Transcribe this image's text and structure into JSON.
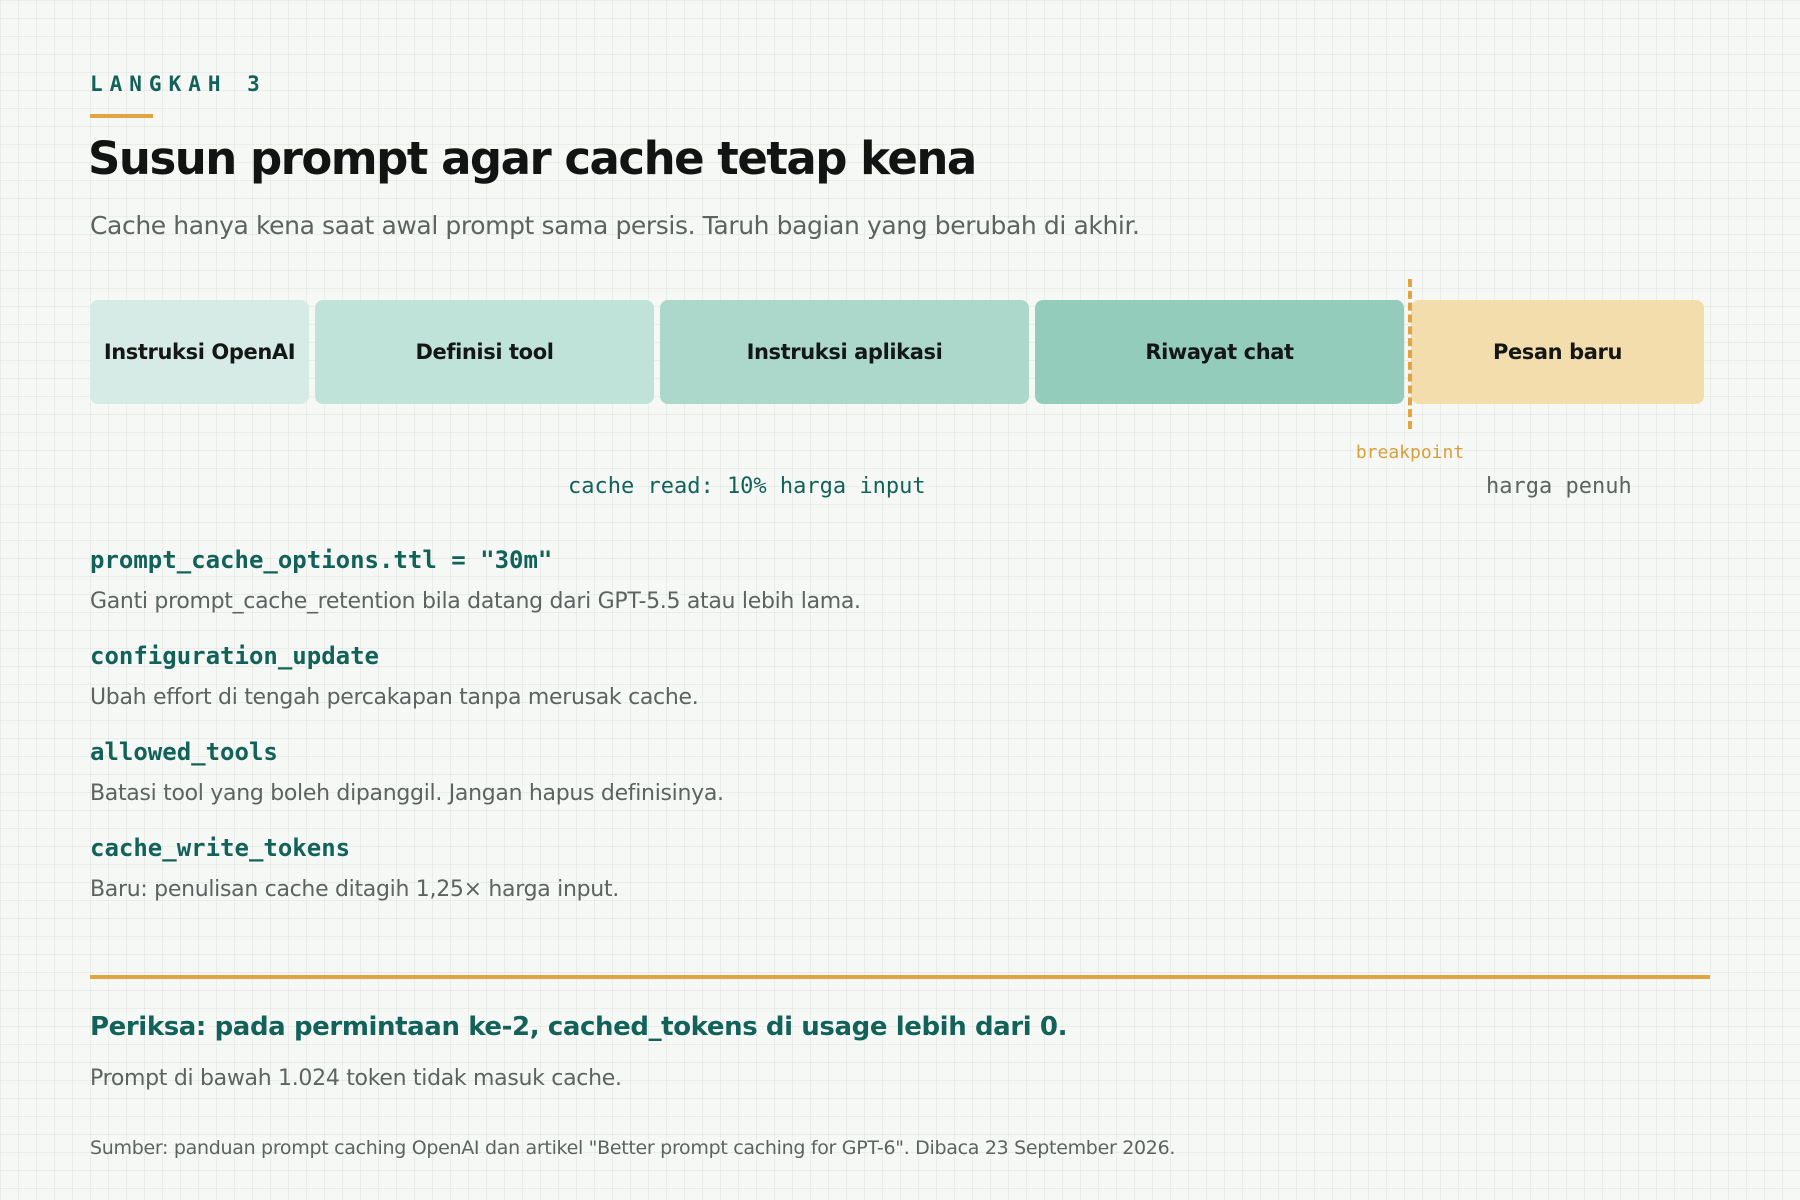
{
  "header": {
    "eyebrow": "LANGKAH 3",
    "title": "Susun prompt agar cache tetap kena",
    "subtitle": "Cache hanya kena saat awal prompt sama persis. Taruh bagian yang berubah di akhir."
  },
  "prompt_bar": {
    "segments": [
      {
        "label": "Instruksi OpenAI",
        "color": "#d6ebe5"
      },
      {
        "label": "Definisi tool",
        "color": "#c0e3d9"
      },
      {
        "label": "Instruksi aplikasi",
        "color": "#acd8cb"
      },
      {
        "label": "Riwayat chat",
        "color": "#94ccbc"
      },
      {
        "label": "Pesan baru",
        "color": "#f3ddad"
      }
    ],
    "breakpoint_label": "breakpoint",
    "breakpoint_color": "#e1a43f",
    "cache_read_label": "cache read: 10% harga input",
    "full_price_label": "harga penuh"
  },
  "options": [
    {
      "code": "prompt_cache_options.ttl = \"30m\"",
      "desc": "Ganti prompt_cache_retention bila datang dari GPT-5.5 atau lebih lama."
    },
    {
      "code": "configuration_update",
      "desc": "Ubah effort di tengah percakapan tanpa merusak cache."
    },
    {
      "code": "allowed_tools",
      "desc": "Batasi tool yang boleh dipanggil. Jangan hapus definisinya."
    },
    {
      "code": "cache_write_tokens",
      "desc": "Baru: penulisan cache ditagih 1,25× harga input."
    }
  ],
  "footer": {
    "check": "Periksa: pada permintaan ke-2, cached_tokens di usage lebih dari 0.",
    "note": "Prompt di bawah 1.024 token tidak masuk cache.",
    "source": "Sumber: panduan prompt caching OpenAI dan artikel \"Better prompt caching for GPT-6\". Dibaca 23 September 2026."
  },
  "colors": {
    "accent": "#12625a",
    "highlight": "#e1a43f",
    "muted_text": "#5c6360"
  }
}
